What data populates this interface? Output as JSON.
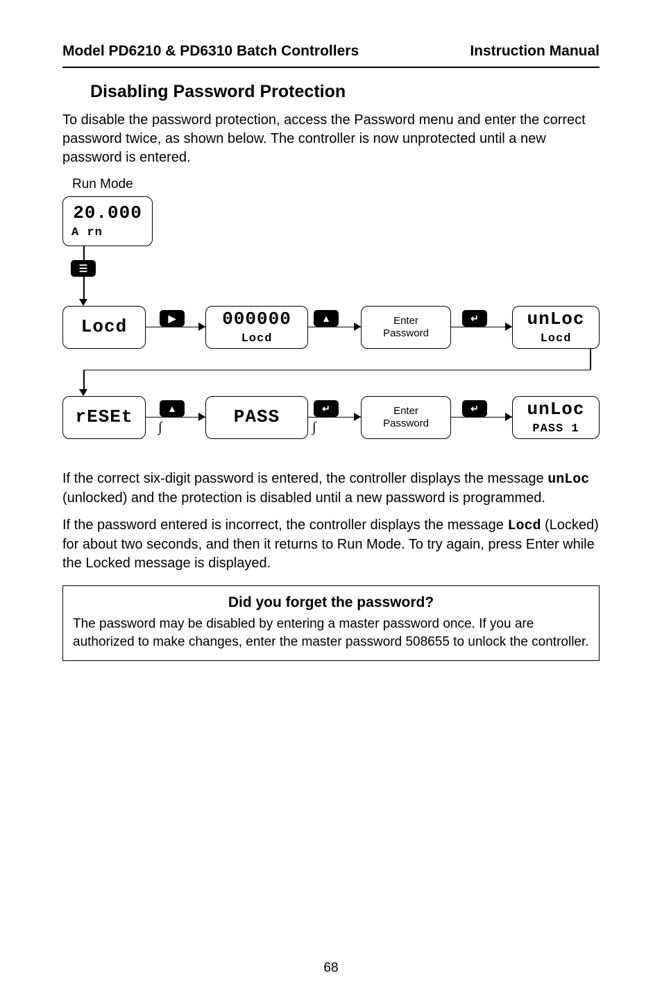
{
  "header": {
    "left": "Model PD6210 & PD6310 Batch Controllers",
    "right": "Instruction Manual"
  },
  "section_title": "Disabling Password Protection",
  "intro": "To disable the password protection, access the Password menu and enter the correct password twice, as shown below. The controller is now unprotected until a new password is entered.",
  "runmode_label": "Run Mode",
  "diagram": {
    "run_display": {
      "top": "20.000",
      "bottom": "A rn"
    },
    "row1": {
      "locd": "Locd",
      "zeros_top": "000000",
      "zeros_bottom": "Locd",
      "enter_top": "Enter",
      "enter_bottom": "Password",
      "unloc_top": "unLoc",
      "unloc_bottom": "Locd"
    },
    "row2": {
      "reset": "rESEt",
      "pass": "PASS",
      "enter_top": "Enter",
      "enter_bottom": "Password",
      "unloc_top": "unLoc",
      "unloc_bottom": "PASS 1"
    },
    "icons": {
      "menu": "☰",
      "right": "▶",
      "up": "▲",
      "enter": "↵"
    }
  },
  "para2a": "If the correct six-digit password is entered, the controller displays the message ",
  "para2_code": "unLoc",
  "para2b": " (unlocked) and the protection is disabled until a new password is programmed.",
  "para3a": "If the password entered is incorrect, the controller displays the message ",
  "para3_code": "Locd",
  "para3b": " (Locked) for about two seconds, and then it returns to Run Mode. To try again, press Enter while the Locked message is displayed.",
  "note": {
    "title": "Did you forget the password?",
    "body": "The password may be disabled by entering a master password once. If you are authorized to make changes, enter the master password 508655 to unlock the controller."
  },
  "page_number": "68"
}
